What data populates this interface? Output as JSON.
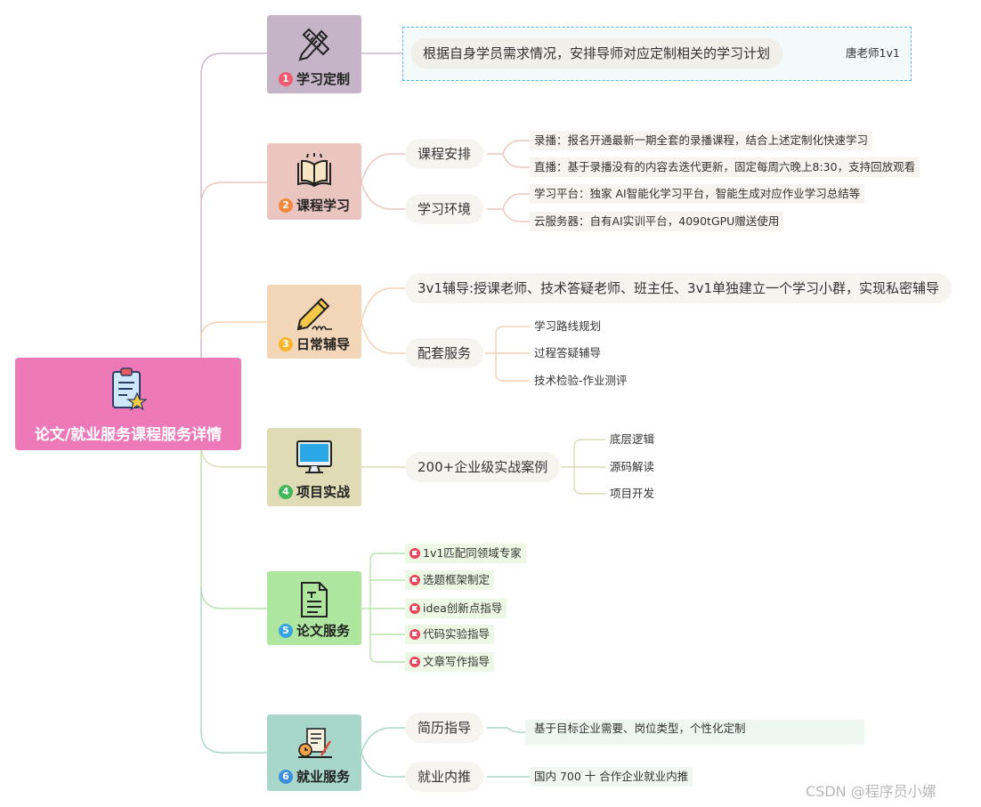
{
  "root": {
    "label": "论文/就业服务课程服务详情",
    "icon": "clipboard-star-icon"
  },
  "branches": [
    {
      "num": "1",
      "label": "学习定制",
      "icon": "pencil-ruler-icon",
      "color": "#c5b3c8",
      "num_color": "#f15a6e"
    },
    {
      "num": "2",
      "label": "课程学习",
      "icon": "open-book-icon",
      "color": "#ebc6c1",
      "num_color": "#f6883c"
    },
    {
      "num": "3",
      "label": "日常辅导",
      "icon": "pencil-writing-icon",
      "color": "#f3d5b8",
      "num_color": "#f7b52b"
    },
    {
      "num": "4",
      "label": "项目实战",
      "icon": "monitor-icon",
      "color": "#dedbb5",
      "num_color": "#3fb85a"
    },
    {
      "num": "5",
      "label": "论文服务",
      "icon": "document-icon",
      "color": "#aee6a0",
      "num_color": "#36a4e2"
    },
    {
      "num": "6",
      "label": "就业服务",
      "icon": "desk-tools-icon",
      "color": "#a8d6c8",
      "num_color": "#3a8fdb"
    }
  ],
  "b1": {
    "text": "根据自身学员需求情况，安排导师对应定制相关的学习计划",
    "tag": "唐老师1v1"
  },
  "b2": {
    "sub1": "课程安排",
    "sub1_leaves": [
      "录播：报名开通最新一期全套的录播课程，结合上述定制化快速学习",
      "直播：基于录播没有的内容去迭代更新，固定每周六晚上8:30，支持回放观看"
    ],
    "sub2": "学习环境",
    "sub2_leaves": [
      "学习平台：独家 AI智能化学习平台，智能生成对应作业学习总结等",
      "云服务器：自有AI实训平台，4090tGPU赠送使用"
    ]
  },
  "b3": {
    "sub1": "3v1辅导:授课老师、技术答疑老师、班主任、3v1单独建立一个学习小群，实现私密辅导",
    "sub2": "配套服务",
    "sub2_leaves": [
      "学习路线规划",
      "过程答疑辅导",
      "技术检验-作业测评"
    ]
  },
  "b4": {
    "sub1": "200+企业级实战案例",
    "leaves": [
      "底层逻辑",
      "源码解读",
      "项目开发"
    ]
  },
  "b5": {
    "leaves": [
      "1v1匹配同领域专家",
      "选题框架制定",
      "idea创新点指导",
      "代码实验指导",
      "文章写作指导"
    ]
  },
  "b6": {
    "sub1": "简历指导",
    "sub1_leaf": "基于目标企业需要、岗位类型，个性化定制",
    "sub2": "就业内推",
    "sub2_leaf": "国内 700 十 合作企业就业内推"
  },
  "watermark": "CSDN @程序员小嫘",
  "colors": {
    "root": "#ee79b8",
    "pill_bg": "#f6f4ef",
    "leaf_bg": "#f7f3ee",
    "flag_leaf_bg": "#ecf7e4",
    "selection_border": "#57b7e3"
  }
}
